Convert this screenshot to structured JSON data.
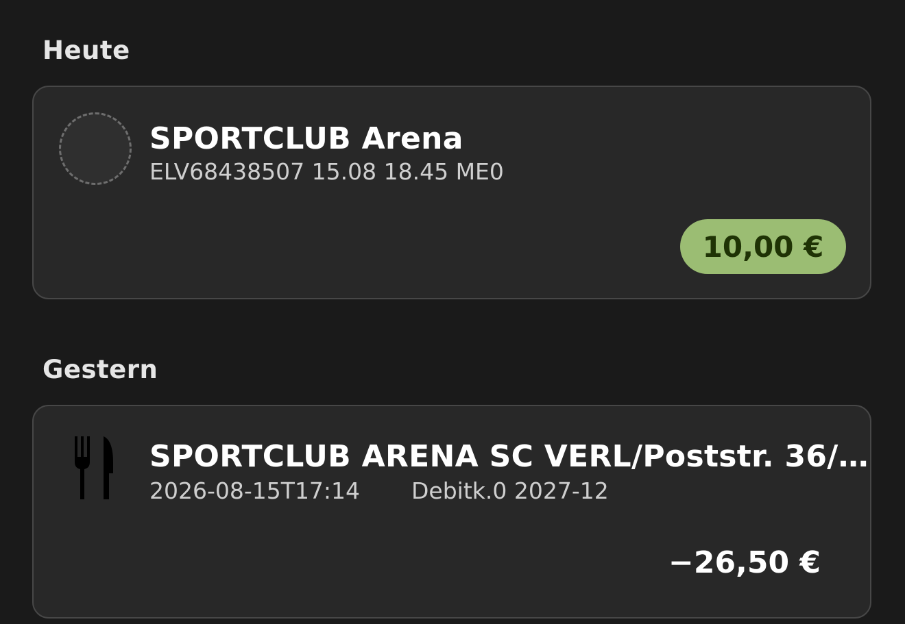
{
  "sections": [
    {
      "heading": "Heute",
      "transaction": {
        "title": "SPORTCLUB Arena",
        "subtitle": "ELV68438507 15.08 18.45 ME0",
        "amount": "10,00 €",
        "amount_type": "credit",
        "icon": "placeholder-avatar-icon"
      }
    },
    {
      "heading": "Gestern",
      "transaction": {
        "title": "SPORTCLUB ARENA SC VERL/Poststr. 36/…",
        "subtitle_date": "2026-08-15T17:14",
        "subtitle_ref": "Debitk.0 2027-12",
        "amount": "−26,50 €",
        "amount_type": "debit",
        "icon": "cutlery-icon"
      }
    }
  ],
  "colors": {
    "background": "#1a1a1a",
    "card": "#282828",
    "credit_pill": "#9bbd73",
    "credit_text": "#1f3305"
  }
}
